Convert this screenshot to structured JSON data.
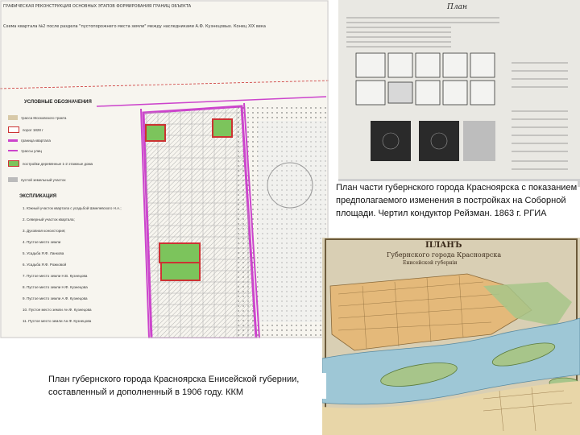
{
  "left_plan": {
    "header_line1": "ГРАФИЧЕСКАЯ РЕКОНСТРУКЦИЯ ОСНОВНЫХ ЭТАПОВ ФОРМИРОВАНИЯ ГРАНИЦ ОБЪЕКТА",
    "header_line2": "Схема квартала №2 после раздела \"пустопорожнего места земли\" между наследниками А.Ф. Кузнецовых. Конец XIX века",
    "legend_title": "УСЛОВНЫЕ ОБОЗНАЧЕНИЯ",
    "legend": [
      {
        "label": "трасса Московского тракта",
        "color": "#d8c9a8"
      },
      {
        "label": "порог 1828 г",
        "color": "#ffffff",
        "border": "#cc3333"
      },
      {
        "label": "граница квартала",
        "color": "#cc44cc"
      },
      {
        "label": "трассы улиц",
        "color": "#cc44cc"
      },
      {
        "label": "постройки деревянные 1-2 этажные дома",
        "color": "#7cc45c",
        "border": "#cc3333"
      },
      {
        "label": "пустой земельный участок",
        "color": "#bbbbbb"
      }
    ],
    "explication_title": "ЭКСПЛИКАЦИЯ",
    "explication": [
      "1. Южный участок квартала с усадьбой Шмелевского Н.А.;",
      "2. Северный участок квартала;",
      "3. Духовная консистория;",
      "4. Пустое место земли",
      "5. Усадьба Я.Ф. Ланкова",
      "6. Усадьба Я.Ф. Рожковой",
      "7. Пустое место земли Н.В. Кузнецова",
      "8. Пустое место земли Н.Ф. Кузнецова",
      "9. Пустое место земли А.Ф. Кузнецова",
      "10. Пустое место земли Ан.Ф. Кузнецова",
      "11. Пустое место земли Ан.Ф. Кузнецова"
    ]
  },
  "plan1863": {
    "title": "План",
    "caption": "План части губернского города Красноярска с показанием предполагаемого изменения в постройках на Соборной площади. Чертил кондуктор Рейзман. 1863 г. РГИА"
  },
  "map1906": {
    "title": "ПЛАНЪ",
    "subtitle": "Губернского города Красноярска",
    "subtitle2": "Енисейской губерніи",
    "caption": "План губернского города Красноярска Енисейской губернии, составленный и дополненный в 1906 году. ККМ"
  },
  "colors": {
    "boundary": "#cc44cc",
    "green_plot": "#7cc45c",
    "red_outline": "#cc3333",
    "river": "#9ec7d6"
  }
}
